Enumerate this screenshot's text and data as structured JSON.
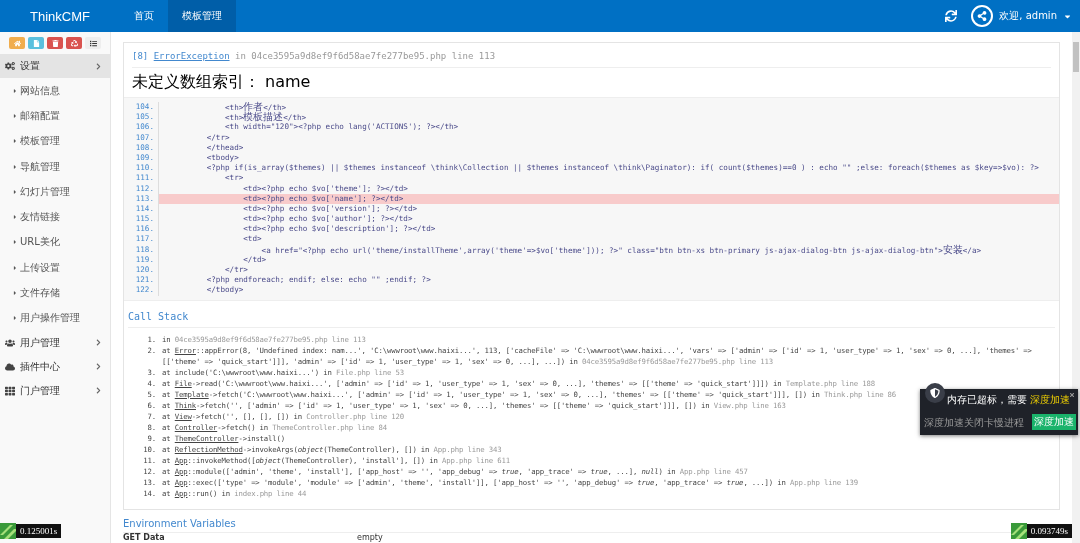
{
  "header": {
    "brand": "ThinkCMF",
    "nav": [
      {
        "label": "首页",
        "selected": false
      },
      {
        "label": "模板管理",
        "selected": true
      }
    ],
    "user": {
      "greeting": "欢迎, admin"
    }
  },
  "sidebar": {
    "toolbar": [
      {
        "kind": "home",
        "color": "#f0ad4e"
      },
      {
        "kind": "file",
        "color": "#5bc0de"
      },
      {
        "kind": "trash",
        "color": "#d9534f"
      },
      {
        "kind": "recycle",
        "color": "#d9534f"
      },
      {
        "kind": "list",
        "color": "#eeeeee"
      }
    ],
    "menu": [
      {
        "label": "设置",
        "expanded": true,
        "children": [
          {
            "label": "网站信息"
          },
          {
            "label": "邮箱配置"
          },
          {
            "label": "模板管理"
          },
          {
            "label": "导航管理"
          },
          {
            "label": "幻灯片管理"
          },
          {
            "label": "友情链接"
          },
          {
            "label": "URL美化"
          },
          {
            "label": "上传设置"
          },
          {
            "label": "文件存储"
          },
          {
            "label": "用户操作管理"
          }
        ]
      },
      {
        "label": "用户管理",
        "expanded": false
      },
      {
        "label": "插件中心",
        "expanded": false
      },
      {
        "label": "门户管理",
        "expanded": false
      }
    ]
  },
  "error": {
    "code": "[8]",
    "type": "ErrorException",
    "location": "in 04ce3595a9d8ef9f6d58ae7fe277be95.php line 113",
    "message": "未定义数组索引： name"
  },
  "source": [
    {
      "number": "104.",
      "text": "              <th>作者</th>",
      "highlighted": false
    },
    {
      "number": "105.",
      "text": "              <th>模板描述</th>",
      "highlighted": false
    },
    {
      "number": "106.",
      "text": "              <th width=\"120\"><?php echo lang('ACTIONS'); ?></th>",
      "highlighted": false
    },
    {
      "number": "107.",
      "text": "          </tr>",
      "highlighted": false
    },
    {
      "number": "108.",
      "text": "          </thead>",
      "highlighted": false
    },
    {
      "number": "109.",
      "text": "          <tbody>",
      "highlighted": false
    },
    {
      "number": "110.",
      "text": "          <?php if(is_array($themes) || $themes instanceof \\think\\Collection || $themes instanceof \\think\\Paginator): if( count($themes)==0 ) : echo \"\" ;else: foreach($themes as $key=>$vo): ?>",
      "highlighted": false
    },
    {
      "number": "111.",
      "text": "              <tr>",
      "highlighted": false
    },
    {
      "number": "112.",
      "text": "                  <td><?php echo $vo['theme']; ?></td>",
      "highlighted": false
    },
    {
      "number": "113.",
      "text": "                  <td><?php echo $vo['name']; ?></td>",
      "highlighted": true
    },
    {
      "number": "114.",
      "text": "                  <td><?php echo $vo['version']; ?></td>",
      "highlighted": false
    },
    {
      "number": "115.",
      "text": "                  <td><?php echo $vo['author']; ?></td>",
      "highlighted": false
    },
    {
      "number": "116.",
      "text": "                  <td><?php echo $vo['description']; ?></td>",
      "highlighted": false
    },
    {
      "number": "117.",
      "text": "                  <td>",
      "highlighted": false
    },
    {
      "number": "118.",
      "text": "                      <a href=\"<?php echo url('theme/installTheme',array('theme'=>$vo['theme'])); ?>\" class=\"btn btn-xs btn-primary js-ajax-dialog-btn js-ajax-dialog-btn\">安装</a>",
      "highlighted": false
    },
    {
      "number": "119.",
      "text": "                  </td>",
      "highlighted": false
    },
    {
      "number": "120.",
      "text": "              </tr>",
      "highlighted": false
    },
    {
      "number": "121.",
      "text": "          <?php endforeach; endif; else: echo \"\" ;endif; ?>",
      "highlighted": false
    },
    {
      "number": "122.",
      "text": "          </tbody>",
      "highlighted": false
    }
  ],
  "call_stack": {
    "title": "Call Stack",
    "items": [
      {
        "number": "1.",
        "prefix": "in",
        "file": "04ce3595a9d8ef9f6d58ae7fe277be95.php line 113"
      },
      {
        "number": "2.",
        "prefix": "at",
        "class": "Error",
        "call": "::appError(8, 'Undefined index: nam...', 'C:\\wwwroot\\www.haixi...', 113, ['cacheFile' => 'C:\\wwwroot\\www.haixi...', 'vars' => ['admin' => ['id' => 1, 'user_type' => 1, 'sex' => 0, ...], 'themes' => [['theme' => 'quick_start']]], 'admin' => ['id' => 1, 'user_type' => 1, 'sex' => 0, ...], ...]) in",
        "file": "04ce3595a9d8ef9f6d58ae7fe277be95.php line 113"
      },
      {
        "number": "3.",
        "prefix": "at",
        "call": "include('C:\\wwwroot\\www.haixi...') in",
        "file": "File.php line 53"
      },
      {
        "number": "4.",
        "prefix": "at",
        "class": "File",
        "call": "->read('C:\\wwwroot\\www.haixi...', ['admin' => ['id' => 1, 'user_type' => 1, 'sex' => 0, ...], 'themes' => [['theme' => 'quick_start']]]) in",
        "file": "Template.php line 188"
      },
      {
        "number": "5.",
        "prefix": "at",
        "class": "Template",
        "call": "->fetch('C:\\wwwroot\\www.haixi...', ['admin' => ['id' => 1, 'user_type' => 1, 'sex' => 0, ...], 'themes' => [['theme' => 'quick_start']]], []) in",
        "file": "Think.php line 86"
      },
      {
        "number": "6.",
        "prefix": "at",
        "class": "Think",
        "call": "->fetch('', ['admin' => ['id' => 1, 'user_type' => 1, 'sex' => 0, ...], 'themes' => [['theme' => 'quick_start']]], []) in",
        "file": "View.php line 163"
      },
      {
        "number": "7.",
        "prefix": "at",
        "class": "View",
        "call": "->fetch('', [], [], []) in",
        "file": "Controller.php line 120"
      },
      {
        "number": "8.",
        "prefix": "at",
        "class": "Controller",
        "call": "->fetch() in",
        "file": "ThemeController.php line 84"
      },
      {
        "number": "9.",
        "prefix": "at",
        "class": "ThemeController",
        "call": "->install()"
      },
      {
        "number": "10.",
        "prefix": "at",
        "class": "ReflectionMethod",
        "call": "->invokeArgs(*object*(ThemeController), []) in",
        "file": "App.php line 343"
      },
      {
        "number": "11.",
        "prefix": "at",
        "class": "App",
        "call": "::invokeMethod([*object*(ThemeController), 'install'], []) in",
        "file": "App.php line 611"
      },
      {
        "number": "12.",
        "prefix": "at",
        "class": "App",
        "call": "::module(['admin', 'theme', 'install'], ['app_host' => '', 'app_debug' => *true*, 'app_trace' => *true*, ...], *null*) in",
        "file": "App.php line 457"
      },
      {
        "number": "13.",
        "prefix": "at",
        "class": "App",
        "call": "::exec(['type' => 'module', 'module' => ['admin', 'theme', 'install']], ['app_host' => '', 'app_debug' => *true*, 'app_trace' => *true*, ...]) in",
        "file": "App.php line 139"
      },
      {
        "number": "14.",
        "prefix": "at",
        "class": "App",
        "call": "::run() in",
        "file": "index.php line 44"
      }
    ]
  },
  "environment": {
    "title": "Environment Variables",
    "rows": [
      {
        "name": "GET Data",
        "value": "empty"
      }
    ]
  },
  "popup": {
    "title": "内存已超标，需要",
    "highlight": "深度加速",
    "subtitle": "深度加速关闭卡慢进程",
    "button": "深度加速"
  },
  "timers": [
    "0.125001s",
    "0.093749s"
  ]
}
